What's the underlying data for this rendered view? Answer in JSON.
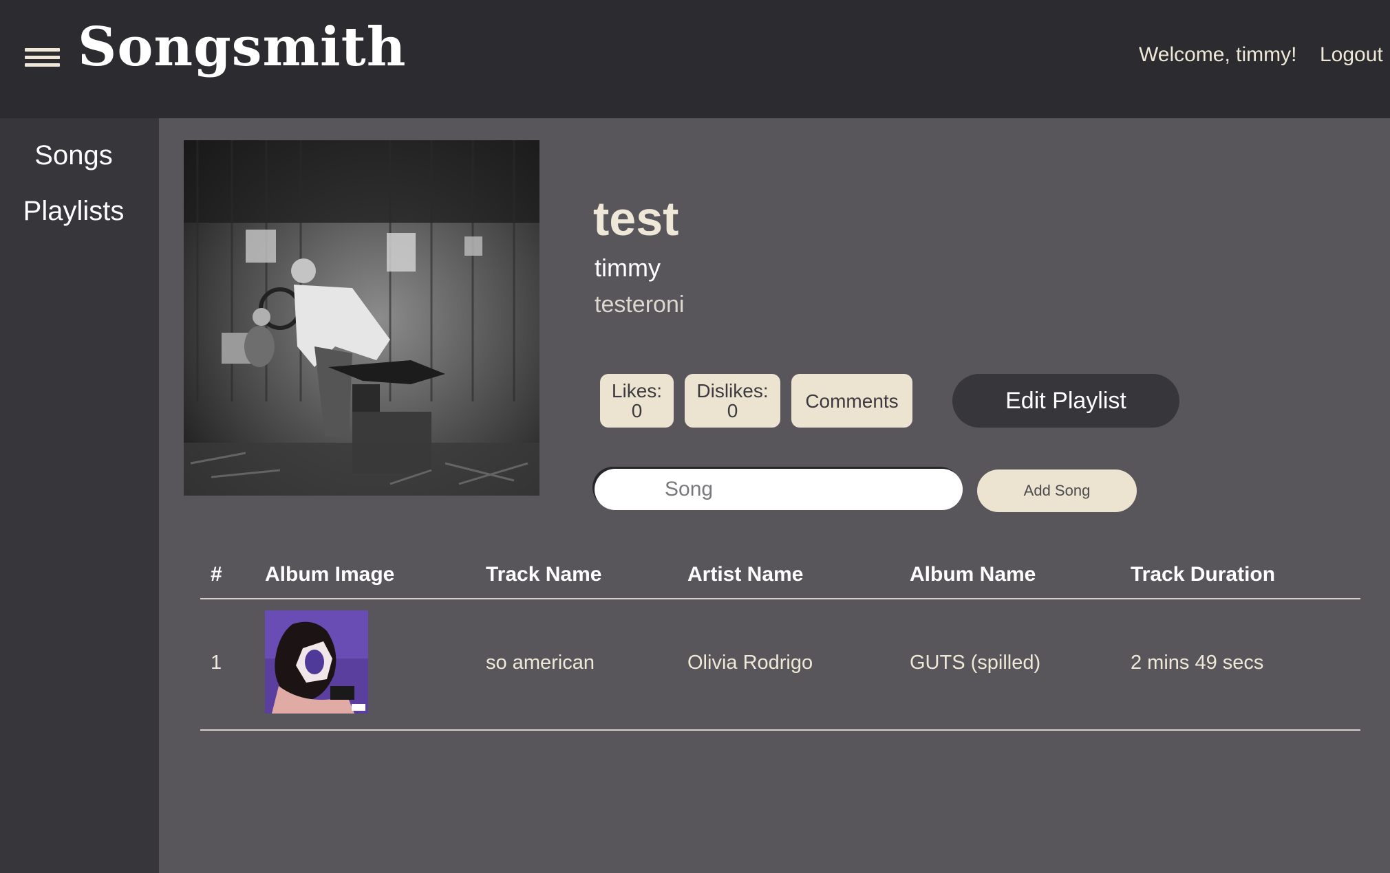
{
  "header": {
    "brand": "Songsmith",
    "welcome": "Welcome, timmy!",
    "logout": "Logout"
  },
  "sidebar": {
    "items": [
      {
        "label": "Songs"
      },
      {
        "label": "Playlists"
      }
    ]
  },
  "playlist": {
    "title": "test",
    "owner": "timmy",
    "description": "testeroni",
    "likes_label": "Likes:",
    "likes_count": "0",
    "dislikes_label": "Dislikes:",
    "dislikes_count": "0",
    "comments_label": "Comments",
    "edit_label": "Edit Playlist"
  },
  "add_song": {
    "placeholder": "Song",
    "value": "",
    "button_label": "Add Song"
  },
  "table": {
    "headers": [
      "#",
      "Album Image",
      "Track Name",
      "Artist Name",
      "Album Name",
      "Track Duration"
    ],
    "rows": [
      {
        "index": "1",
        "track": "so american",
        "artist": "Olivia Rodrigo",
        "album": "GUTS (spilled)",
        "duration": "2 mins 49 secs"
      }
    ]
  },
  "colors": {
    "topbar": "#2c2b30",
    "sidebar": "#37363b",
    "main": "#58565b",
    "cream": "#ece4d1"
  }
}
